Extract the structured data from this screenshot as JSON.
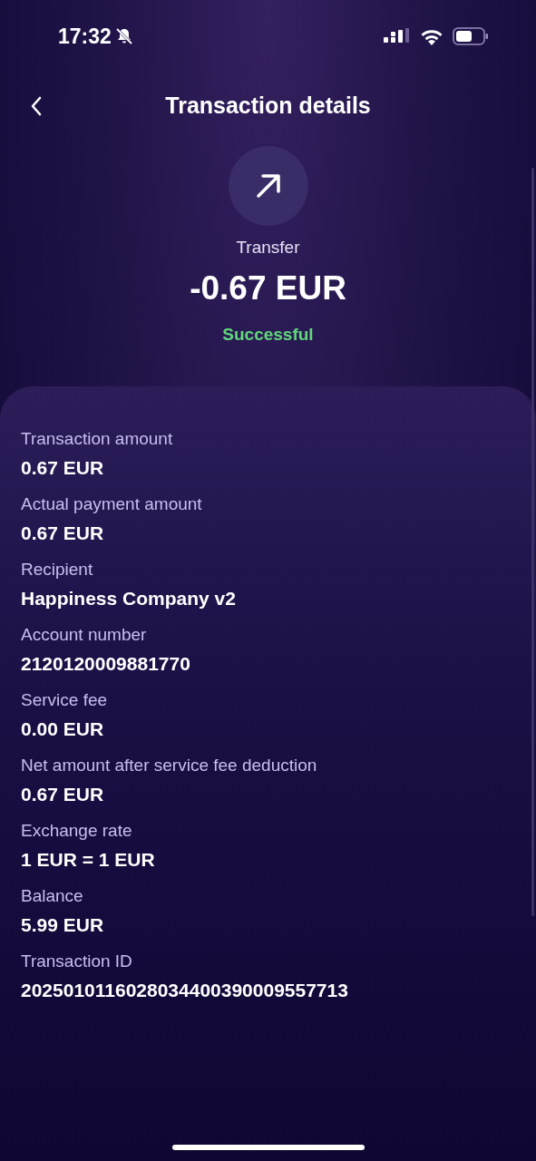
{
  "status_bar": {
    "time": "17:32"
  },
  "header": {
    "title": "Transaction details"
  },
  "summary": {
    "type": "Transfer",
    "amount": "-0.67 EUR",
    "status": "Successful"
  },
  "details": [
    {
      "label": "Transaction amount",
      "value": "0.67 EUR"
    },
    {
      "label": "Actual payment amount",
      "value": "0.67 EUR"
    },
    {
      "label": "Recipient",
      "value": "Happiness Company v2"
    },
    {
      "label": "Account number",
      "value": "2120120009881770"
    },
    {
      "label": "Service fee",
      "value": "0.00 EUR"
    },
    {
      "label": "Net amount after service fee deduction",
      "value": "0.67 EUR"
    },
    {
      "label": "Exchange rate",
      "value": "1 EUR = 1 EUR"
    },
    {
      "label": "Balance",
      "value": "5.99 EUR"
    },
    {
      "label": "Transaction ID",
      "value": "2025010116028034400390009557713"
    }
  ]
}
